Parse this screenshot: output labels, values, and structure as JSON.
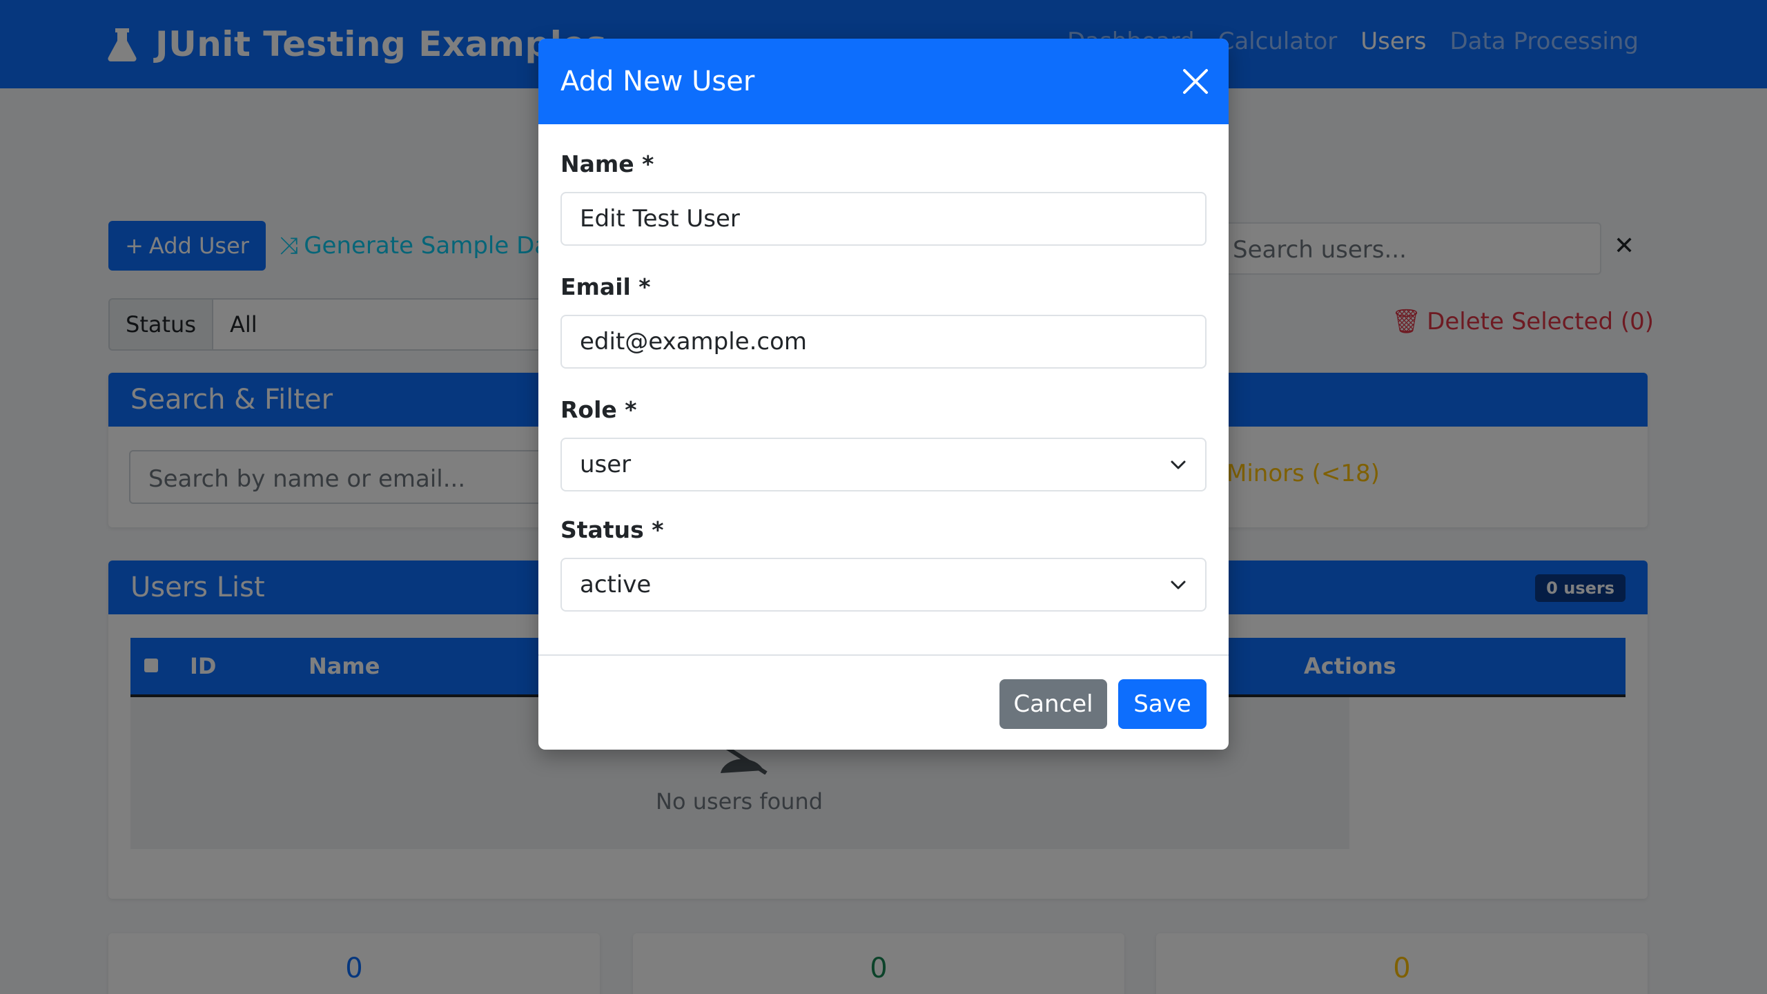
{
  "navbar": {
    "brand": "JUnit Testing Examples",
    "links": [
      "Dashboard",
      "Calculator",
      "Users",
      "Data Processing"
    ],
    "active": "Users"
  },
  "toolbar": {
    "add_user": "Add User",
    "generate": "Generate Sample Data",
    "search_placeholder": "Search users...",
    "status_label": "Status",
    "status_value": "All",
    "delete_selected": "Delete Selected (0)"
  },
  "search_card": {
    "title": "Search & Filter",
    "placeholder": "Search by name or email...",
    "minors": "Minors (<18)"
  },
  "users_card": {
    "title": "Users List",
    "badge": "0 users",
    "columns": [
      "ID",
      "Name",
      "Actions"
    ],
    "empty": "No users found"
  },
  "stats": [
    "0",
    "0",
    "0"
  ],
  "colors": {
    "primary": "#0d6efd",
    "info": "#0dcaf0",
    "danger": "#dc3545",
    "warning": "#ffc107",
    "success": "#198754",
    "secondary": "#6c757d"
  },
  "modal": {
    "title": "Add New User",
    "fields": {
      "name": {
        "label": "Name *",
        "value": "Edit Test User"
      },
      "email": {
        "label": "Email *",
        "value": "edit@example.com"
      },
      "role": {
        "label": "Role *",
        "value": "user"
      },
      "status": {
        "label": "Status *",
        "value": "active"
      }
    },
    "cancel": "Cancel",
    "save": "Save"
  }
}
